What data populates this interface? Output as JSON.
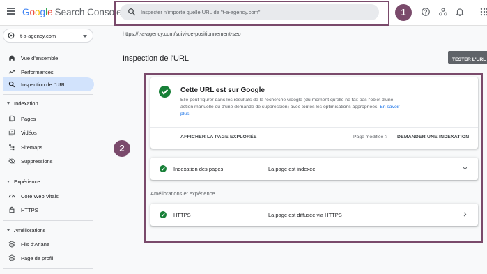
{
  "header": {
    "logo_google": [
      "G",
      "o",
      "o",
      "g",
      "l",
      "e"
    ],
    "logo_product": "Search Console",
    "search_placeholder": "Inspecter n'importe quelle URL de \"t-a-agency.com\"",
    "icons": [
      "help-icon",
      "manage-users-icon",
      "notifications-icon",
      "apps-grid-icon"
    ]
  },
  "annotations": {
    "badge1": "1",
    "badge2": "2"
  },
  "sidebar": {
    "property": "t-a-agency.com",
    "items": [
      {
        "label": "Vue d'ensemble",
        "icon": "home-icon"
      },
      {
        "label": "Performances",
        "icon": "trending-icon"
      },
      {
        "label": "Inspection de l'URL",
        "icon": "search-icon",
        "active": true
      }
    ],
    "sections": [
      {
        "label": "Indexation",
        "items": [
          {
            "label": "Pages",
            "icon": "pages-icon"
          },
          {
            "label": "Vidéos",
            "icon": "videos-icon"
          },
          {
            "label": "Sitemaps",
            "icon": "sitemap-icon"
          },
          {
            "label": "Suppressions",
            "icon": "removals-icon"
          }
        ]
      },
      {
        "label": "Expérience",
        "items": [
          {
            "label": "Core Web Vitals",
            "icon": "gauge-icon"
          },
          {
            "label": "HTTPS",
            "icon": "lock-icon"
          }
        ]
      },
      {
        "label": "Améliorations",
        "items": [
          {
            "label": "Fils d'Ariane",
            "icon": "breadcrumbs-icon"
          },
          {
            "label": "Page de profil",
            "icon": "profile-page-icon"
          }
        ]
      }
    ]
  },
  "main": {
    "url": "https://t-a-agency.com/suivi-de-positionnement-seo",
    "title": "Inspection de l'URL",
    "test_button": "TESTER L'URL A",
    "status_card": {
      "title": "Cette URL est sur Google",
      "description": "Elle peut figurer dans les résultats de la recherche Google (du moment qu'elle ne fait pas l'objet d'une action manuelle ou d'une demande de suppression) avec toutes les optimisations appropriées.",
      "link": "En savoir plus",
      "view_crawled": "AFFICHER LA PAGE EXPLORÉE",
      "modified": "Page modifiée ?",
      "request_indexing": "DEMANDER UNE INDEXATION"
    },
    "rows": [
      {
        "label": "Indexation des pages",
        "status": "La page est indexée",
        "chevron": "chevron-down-icon"
      },
      {
        "label": "HTTPS",
        "status": "La page est diffusée via HTTPS",
        "chevron": "chevron-right-icon"
      }
    ],
    "subsection": "Améliorations et expérience"
  },
  "colors": {
    "accent_frame": "#7a4a6b",
    "check_green": "#188038",
    "active_nav": "#d2e3fc",
    "link": "#1a73e8"
  }
}
